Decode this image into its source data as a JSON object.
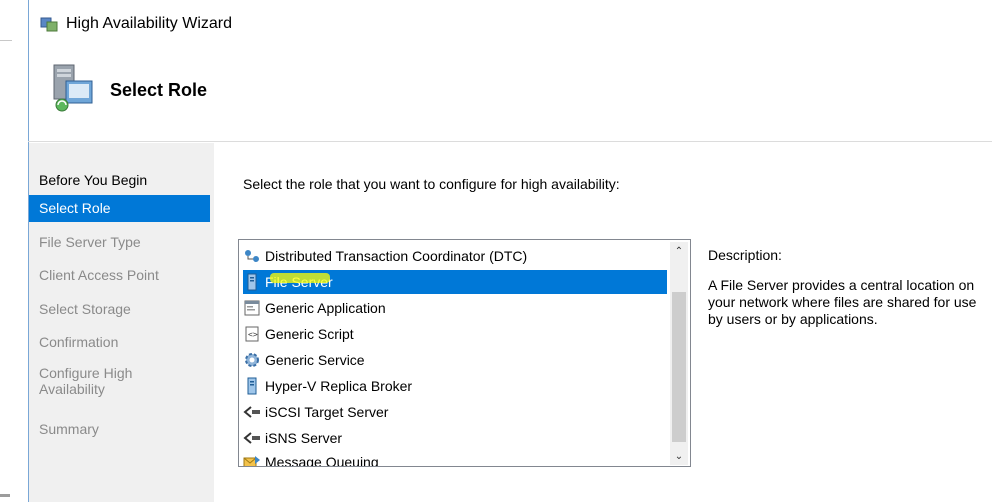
{
  "window": {
    "title": "High Availability Wizard",
    "icon": "wizard-app-icon"
  },
  "header": {
    "title": "Select Role",
    "icon": "cluster-server-icon"
  },
  "nav": {
    "items": [
      {
        "label": "Before You Begin",
        "state": "enabled"
      },
      {
        "label": "Select Role",
        "state": "active"
      },
      {
        "label": "File Server Type",
        "state": "disabled"
      },
      {
        "label": "Client Access Point",
        "state": "disabled"
      },
      {
        "label": "Select Storage",
        "state": "disabled"
      },
      {
        "label": "Confirmation",
        "state": "disabled"
      },
      {
        "label": "Configure High Availability",
        "state": "disabled"
      },
      {
        "label": "Summary",
        "state": "disabled"
      }
    ]
  },
  "main": {
    "prompt": "Select the role that you want to configure for high availability:",
    "roles": [
      {
        "label": "Distributed Transaction Coordinator (DTC)",
        "icon": "dtc-icon",
        "selected": false
      },
      {
        "label": "File Server",
        "icon": "server-tower-icon",
        "selected": true
      },
      {
        "label": "Generic Application",
        "icon": "application-window-icon",
        "selected": false
      },
      {
        "label": "Generic Script",
        "icon": "script-icon",
        "selected": false
      },
      {
        "label": "Generic Service",
        "icon": "gear-icon",
        "selected": false
      },
      {
        "label": "Hyper-V Replica Broker",
        "icon": "server-tower-icon",
        "selected": false
      },
      {
        "label": "iSCSI Target Server",
        "icon": "iscsi-icon",
        "selected": false
      },
      {
        "label": "iSNS Server",
        "icon": "isns-icon",
        "selected": false
      },
      {
        "label": "Message Queuing",
        "icon": "message-queue-icon",
        "selected": false
      }
    ],
    "description": {
      "label": "Description:",
      "text": "A File Server provides a central location on your network where files are shared for use by users or by applications."
    }
  },
  "colors": {
    "accent": "#0078d7",
    "nav_background": "#f0f0f0",
    "disabled_text": "#8a8a8a",
    "highlight": "#ffff00"
  }
}
